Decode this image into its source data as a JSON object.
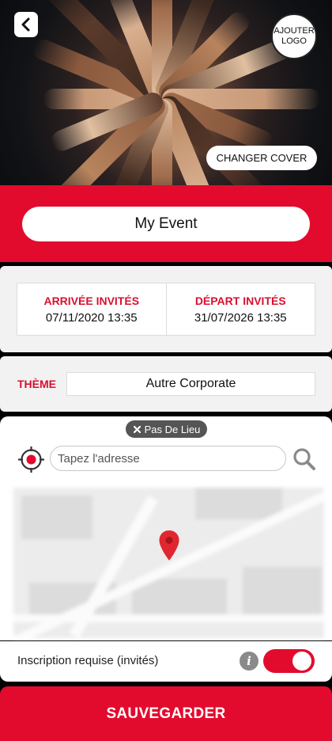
{
  "cover": {
    "logo_button_label": "AJOUTER LOGO",
    "change_cover_label": "CHANGER COVER"
  },
  "event": {
    "name": "My Event"
  },
  "dates": {
    "arrival_label": "ARRIVÉE INVITÉS",
    "arrival_value": "07/11/2020 13:35",
    "departure_label": "DÉPART INVITÉS",
    "departure_value": "31/07/2026 13:35"
  },
  "theme": {
    "label": "THÈME",
    "value": "Autre Corporate"
  },
  "location": {
    "no_place_label": "Pas De Lieu",
    "address_placeholder": "Tapez l'adresse"
  },
  "signup": {
    "label": "Inscription requise (invités)",
    "info_icon": "i",
    "enabled": true
  },
  "save_label": "SAUVEGARDER",
  "colors": {
    "accent": "#e30b2d",
    "label_red": "#d90f2f",
    "card_bg": "#f2f2f2"
  },
  "icons": [
    "back-chevron-icon",
    "target-icon",
    "search-icon",
    "close-icon",
    "map-pin-icon",
    "info-icon"
  ]
}
